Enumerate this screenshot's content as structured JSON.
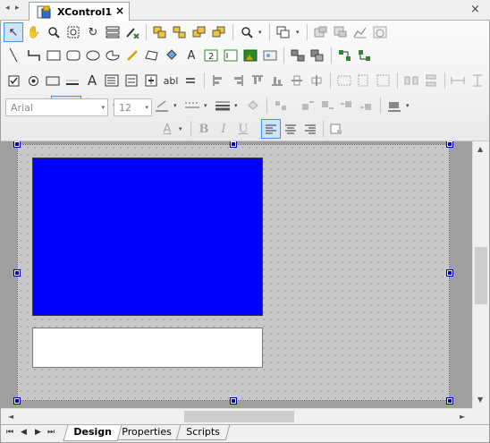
{
  "tab": {
    "title": "XControl1",
    "close": "×"
  },
  "window": {
    "close": "×",
    "tab_left": "◂",
    "tab_right": "▸"
  },
  "font": {
    "name": "Arial",
    "size": "12",
    "arrow": "▾"
  },
  "design": {
    "fill_color": "#0000ff",
    "canvas_color": "#c8c8c8",
    "handle_color": "#0000cc"
  },
  "scroll": {
    "up": "▲",
    "down": "▼",
    "left": "◄",
    "right": "►"
  },
  "bottom_tabs": [
    {
      "label": "Design",
      "active": true
    },
    {
      "label": "Properties",
      "active": false
    },
    {
      "label": "Scripts",
      "active": false
    }
  ],
  "nav": {
    "first": "⏮",
    "prev": "◀",
    "next": "▶",
    "last": "⏭"
  },
  "toolbar_glyphs": {
    "pointer": "↖",
    "pan": "✋",
    "zoom": "🔍",
    "rotate": "↻",
    "dropdown": "▾",
    "text": "A",
    "bold": "B",
    "italic": "I",
    "underline": "U",
    "line": "╲",
    "textbox_abl": "abl",
    "number_two": "2"
  }
}
